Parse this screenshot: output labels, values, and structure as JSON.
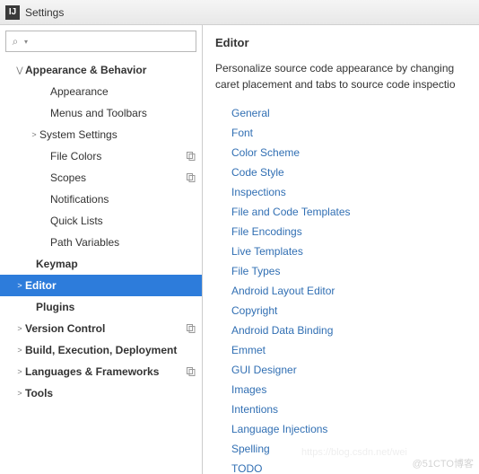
{
  "window": {
    "title": "Settings"
  },
  "search": {
    "placeholder": ""
  },
  "tree": [
    {
      "label": "Appearance & Behavior",
      "bold": true,
      "expandable": true,
      "expanded": true,
      "indent": 16,
      "copy": false
    },
    {
      "label": "Appearance",
      "bold": false,
      "expandable": false,
      "expanded": false,
      "indent": 44,
      "copy": false
    },
    {
      "label": "Menus and Toolbars",
      "bold": false,
      "expandable": false,
      "expanded": false,
      "indent": 44,
      "copy": false
    },
    {
      "label": "System Settings",
      "bold": false,
      "expandable": true,
      "expanded": false,
      "indent": 32,
      "copy": false
    },
    {
      "label": "File Colors",
      "bold": false,
      "expandable": false,
      "expanded": false,
      "indent": 44,
      "copy": true
    },
    {
      "label": "Scopes",
      "bold": false,
      "expandable": false,
      "expanded": false,
      "indent": 44,
      "copy": true
    },
    {
      "label": "Notifications",
      "bold": false,
      "expandable": false,
      "expanded": false,
      "indent": 44,
      "copy": false
    },
    {
      "label": "Quick Lists",
      "bold": false,
      "expandable": false,
      "expanded": false,
      "indent": 44,
      "copy": false
    },
    {
      "label": "Path Variables",
      "bold": false,
      "expandable": false,
      "expanded": false,
      "indent": 44,
      "copy": false
    },
    {
      "label": "Keymap",
      "bold": true,
      "expandable": false,
      "expanded": false,
      "indent": 28,
      "copy": false
    },
    {
      "label": "Editor",
      "bold": true,
      "expandable": true,
      "expanded": false,
      "indent": 16,
      "copy": false,
      "selected": true
    },
    {
      "label": "Plugins",
      "bold": true,
      "expandable": false,
      "expanded": false,
      "indent": 28,
      "copy": false
    },
    {
      "label": "Version Control",
      "bold": true,
      "expandable": true,
      "expanded": false,
      "indent": 16,
      "copy": true
    },
    {
      "label": "Build, Execution, Deployment",
      "bold": true,
      "expandable": true,
      "expanded": false,
      "indent": 16,
      "copy": false
    },
    {
      "label": "Languages & Frameworks",
      "bold": true,
      "expandable": true,
      "expanded": false,
      "indent": 16,
      "copy": true
    },
    {
      "label": "Tools",
      "bold": true,
      "expandable": true,
      "expanded": false,
      "indent": 16,
      "copy": false
    }
  ],
  "panel": {
    "heading": "Editor",
    "description": "Personalize source code appearance by changing caret placement and tabs to source code inspectio",
    "links": [
      "General",
      "Font",
      "Color Scheme",
      "Code Style",
      "Inspections",
      "File and Code Templates",
      "File Encodings",
      "Live Templates",
      "File Types",
      "Android Layout Editor",
      "Copyright",
      "Android Data Binding",
      "Emmet",
      "GUI Designer",
      "Images",
      "Intentions",
      "Language Injections",
      "Spelling",
      "TODO"
    ]
  },
  "watermark": "@51CTO博客",
  "watermark2": "https://blog.csdn.net/wei"
}
